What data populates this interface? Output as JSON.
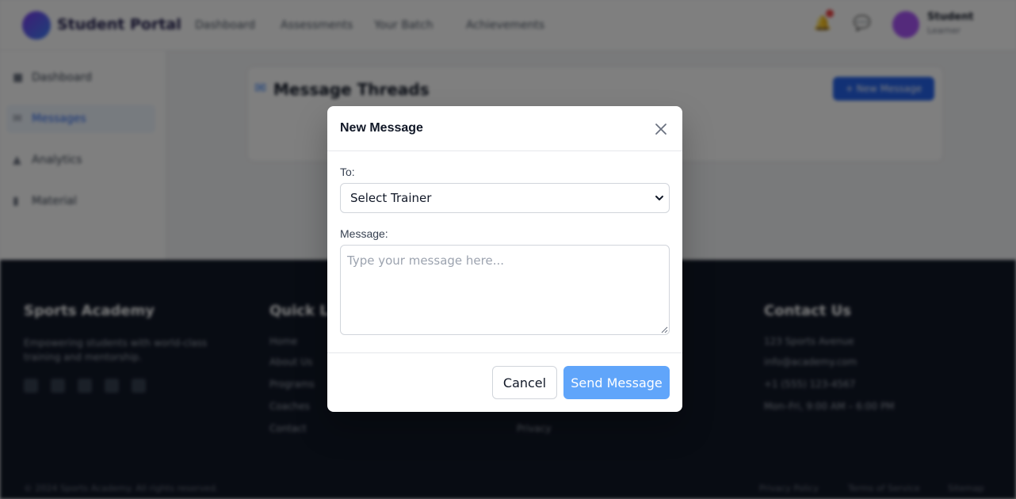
{
  "header": {
    "brand": "Student Portal",
    "nav": [
      "Dashboard",
      "Assessments",
      "Your Batch",
      "Achievements"
    ],
    "user_name": "Student",
    "user_role": "Learner"
  },
  "sidebar": {
    "items": [
      {
        "label": "Dashboard",
        "icon": "dashboard-icon"
      },
      {
        "label": "Messages",
        "icon": "message-icon",
        "active": true
      },
      {
        "label": "Analytics",
        "icon": "chart-icon"
      },
      {
        "label": "Material",
        "icon": "book-icon"
      }
    ]
  },
  "main": {
    "title": "Message Threads",
    "new_button": "+ New Message"
  },
  "footer": {
    "col1_title": "Sports Academy",
    "col1_desc": "Empowering students with world-class training and mentorship.",
    "col2_title": "Quick Links",
    "col2_links": [
      "Home",
      "About Us",
      "Programs",
      "Coaches",
      "Contact"
    ],
    "col3_link5": "Privacy",
    "col4_title": "Contact Us",
    "col4_lines": [
      "123 Sports Avenue",
      "info@academy.com",
      "+1 (555) 123-4567",
      "Mon–Fri, 9:00 AM – 6:00 PM"
    ],
    "copyright": "© 2024 Sports Academy. All rights reserved.",
    "bottom_links": [
      "Privacy Policy",
      "Terms of Service",
      "Sitemap"
    ]
  },
  "modal": {
    "title": "New Message",
    "to_label": "To:",
    "to_selected": "Select Trainer",
    "message_label": "Message:",
    "message_placeholder": "Type your message here...",
    "cancel_label": "Cancel",
    "send_label": "Send Message"
  },
  "colors": {
    "primary": "#60a5fa",
    "overlay": "rgba(0,0,0,0.5)"
  }
}
